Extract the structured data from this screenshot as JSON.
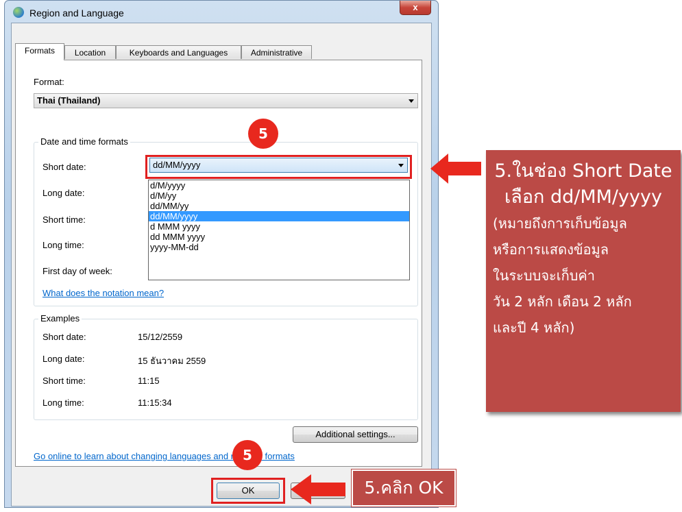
{
  "window": {
    "title": "Region and Language",
    "close_label": "x"
  },
  "tabs": [
    {
      "label": "Formats",
      "active": true
    },
    {
      "label": "Location",
      "active": false
    },
    {
      "label": "Keyboards and Languages",
      "active": false
    },
    {
      "label": "Administrative",
      "active": false
    }
  ],
  "format": {
    "label": "Format:",
    "value": "Thai (Thailand)"
  },
  "date_time_group": {
    "title": "Date and time formats",
    "short_date_label": "Short date:",
    "short_date_value": "dd/MM/yyyy",
    "long_date_label": "Long date:",
    "short_time_label": "Short time:",
    "long_time_label": "Long time:",
    "first_day_label": "First day of week:",
    "notation_link": "What does the notation mean?"
  },
  "dropdown_options": [
    {
      "label": "d/M/yyyy",
      "selected": false
    },
    {
      "label": "d/M/yy",
      "selected": false
    },
    {
      "label": "dd/MM/yy",
      "selected": false
    },
    {
      "label": "dd/MM/yyyy",
      "selected": true
    },
    {
      "label": "d MMM yyyy",
      "selected": false
    },
    {
      "label": "dd MMM yyyy",
      "selected": false
    },
    {
      "label": "yyyy-MM-dd",
      "selected": false
    }
  ],
  "examples": {
    "title": "Examples",
    "rows": [
      {
        "label": "Short date:",
        "value": "15/12/2559"
      },
      {
        "label": "Long date:",
        "value": "15 ธันวาคม 2559"
      },
      {
        "label": "Short time:",
        "value": "11:15"
      },
      {
        "label": "Long time:",
        "value": "11:15:34"
      }
    ]
  },
  "additional_settings_label": "Additional settings...",
  "online_link": "Go online to learn about changing languages and regional formats",
  "ok_label": "OK",
  "annotations": {
    "badge_top": "5",
    "badge_bottom": "5",
    "callout_main_line1": "5.ในช่อง Short Date",
    "callout_main_line2": "เลือก dd/MM/yyyy",
    "callout_sub_lines": [
      "(หมายถึงการเก็บข้อมูล",
      "หรือการแสดงข้อมูล",
      "ในระบบจะเก็บค่า",
      "วัน 2 หลัก เดือน 2 หลัก",
      "และปี 4 หลัก)"
    ],
    "callout_ok": "5.คลิก OK"
  },
  "colors": {
    "callout_bg": "#bb4a46",
    "highlight_red": "#e02020",
    "selection_blue": "#3399ff",
    "link_blue": "#0066cc"
  }
}
